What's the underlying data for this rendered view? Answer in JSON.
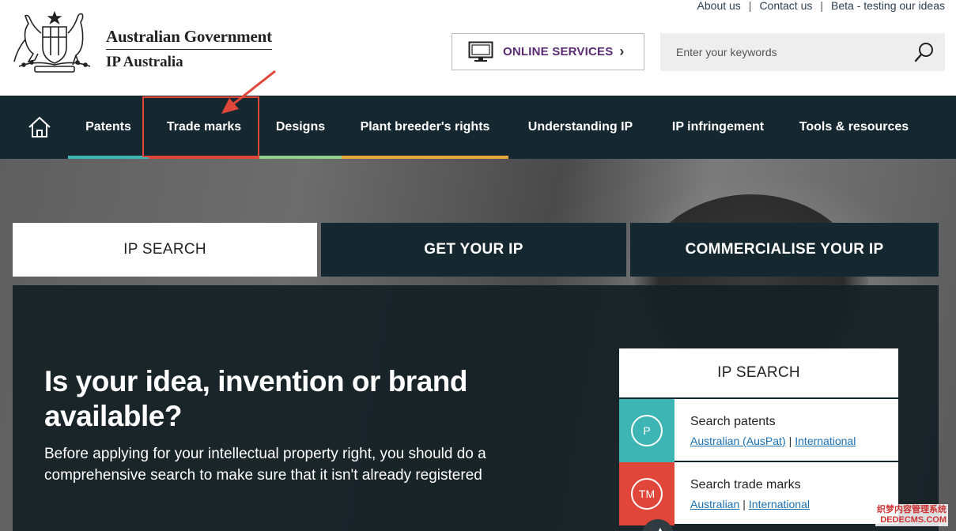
{
  "utility_links": [
    "About us",
    "Contact us",
    "Beta - testing our ideas"
  ],
  "logo": {
    "government": "Australian Government",
    "agency": "IP Australia"
  },
  "online_services": {
    "label": "ONLINE SERVICES",
    "icon": "monitor-icon"
  },
  "search": {
    "placeholder": "Enter your keywords",
    "icon": "search-icon"
  },
  "nav": {
    "home_icon": "home-icon",
    "items": [
      {
        "label": "Patents",
        "bar_color": "#3eb5b5"
      },
      {
        "label": "Trade marks",
        "bar_color": "#e0463a"
      },
      {
        "label": "Designs",
        "bar_color": "#8fd08a"
      },
      {
        "label": "Plant breeder's rights",
        "bar_color": "#e9a83a"
      },
      {
        "label": "Understanding IP",
        "bar_color": ""
      },
      {
        "label": "IP infringement",
        "bar_color": ""
      },
      {
        "label": "Tools & resources",
        "bar_color": ""
      }
    ]
  },
  "tabs": [
    "IP SEARCH",
    "GET YOUR IP",
    "COMMERCIALISE YOUR IP"
  ],
  "hero": {
    "heading": "Is your idea, invention or brand available?",
    "body": "Before applying for your intellectual property right, you should do a comprehensive search to make sure that it isn't already registered"
  },
  "ip_search_card": {
    "title": "IP SEARCH",
    "rows": [
      {
        "badge": "P",
        "title": "Search patents",
        "links": [
          "Australian (AusPat)",
          "International"
        ],
        "color": "#3eb5b5"
      },
      {
        "badge": "TM",
        "title": "Search trade marks",
        "links": [
          "Australian",
          "International"
        ],
        "color": "#e0463a"
      }
    ]
  },
  "watermark": [
    "织梦内容管理系统",
    "DEDECMS.COM"
  ],
  "colors": {
    "nav_bg": "#16282f",
    "accent_purple": "#5a2a73",
    "annotation_red": "#e0463a"
  }
}
